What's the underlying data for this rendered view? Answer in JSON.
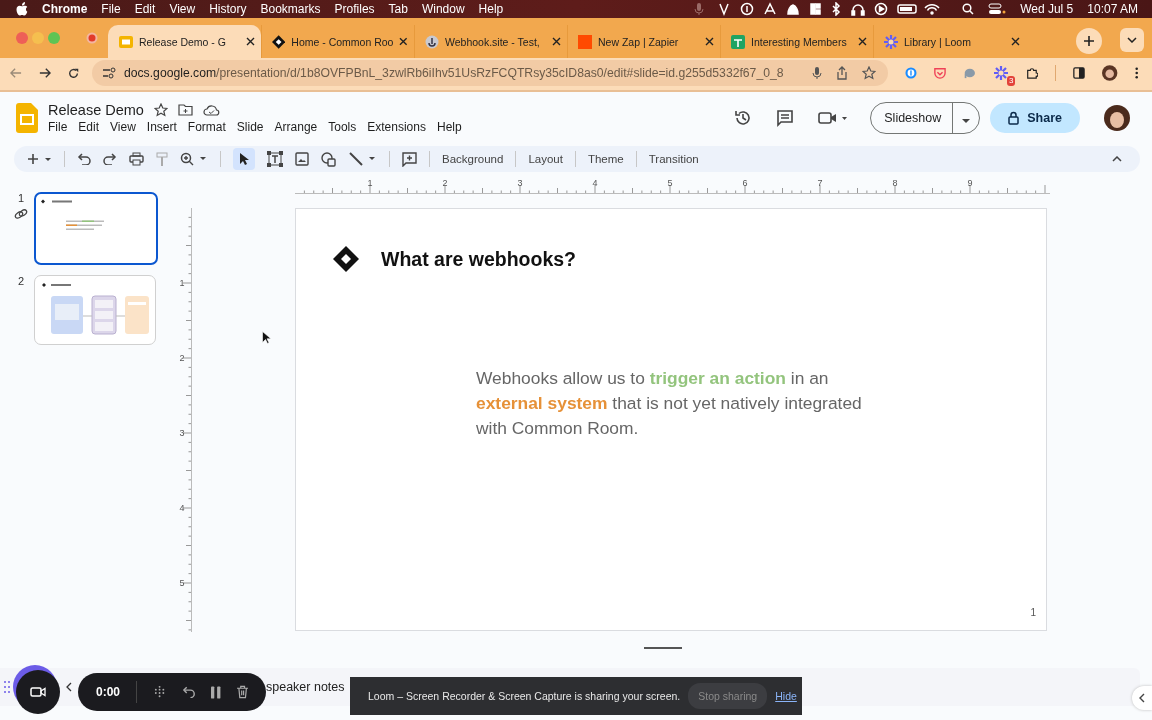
{
  "menubar": {
    "app": "Chrome",
    "menus": [
      "File",
      "Edit",
      "View",
      "History",
      "Bookmarks",
      "Profiles",
      "Tab",
      "Window",
      "Help"
    ],
    "date": "Wed Jul 5",
    "time": "10:07 AM"
  },
  "tabs": [
    {
      "title": "Release Demo - G",
      "kind": "slides",
      "selected": true
    },
    {
      "title": "Home - Common Roo",
      "kind": "diamond",
      "selected": false
    },
    {
      "title": "Webhook.site - Test,",
      "kind": "webhook",
      "selected": false
    },
    {
      "title": "New Zap | Zapier",
      "kind": "zapier",
      "selected": false
    },
    {
      "title": "Interesting Members",
      "kind": "sheets",
      "selected": false
    },
    {
      "title": "Library | Loom",
      "kind": "loom",
      "selected": false
    }
  ],
  "address_bar": {
    "host": "docs.google.com",
    "path": "/presentation/d/1b8OVFPBnL_3zwlRb6iIhv51UsRzFCQTRsy35cID8as0/edit#slide=id.g255d5332f67_0_8",
    "extension_badge": "3"
  },
  "document": {
    "title": "Release Demo",
    "menus": [
      "File",
      "Edit",
      "View",
      "Insert",
      "Format",
      "Slide",
      "Arrange",
      "Tools",
      "Extensions",
      "Help"
    ],
    "slideshow": "Slideshow",
    "share": "Share"
  },
  "toolbar": {
    "buttons": [
      "Background",
      "Layout",
      "Theme",
      "Transition"
    ]
  },
  "slides": [
    {
      "number": "1",
      "kind": "text",
      "selected": true
    },
    {
      "number": "2",
      "kind": "diagram",
      "selected": false
    }
  ],
  "ruler": {
    "horizontal": [
      "1",
      "2",
      "3",
      "4",
      "5",
      "6",
      "7",
      "8",
      "9"
    ],
    "vertical": [
      "1",
      "2",
      "3",
      "4",
      "5"
    ]
  },
  "slide": {
    "title": "What are webhooks?",
    "body": [
      {
        "text": "Webhooks allow us to ",
        "color": "#666666",
        "bold": false
      },
      {
        "text": "trigger an action",
        "color": "#93c47d",
        "bold": true
      },
      {
        "text": " in an ",
        "color": "#666666",
        "bold": false
      },
      {
        "text": "external system",
        "color": "#e69138",
        "bold": true
      },
      {
        "text": " that is not yet natively integrated with Common Room.",
        "color": "#666666",
        "bold": false
      }
    ],
    "page_number": "1"
  },
  "speaker_notes": {
    "text": "speaker notes"
  },
  "loom": {
    "timer": "0:00",
    "banner": "Loom – Screen Recorder & Screen Capture is sharing your screen.",
    "stop": "Stop sharing",
    "hide": "Hide"
  }
}
